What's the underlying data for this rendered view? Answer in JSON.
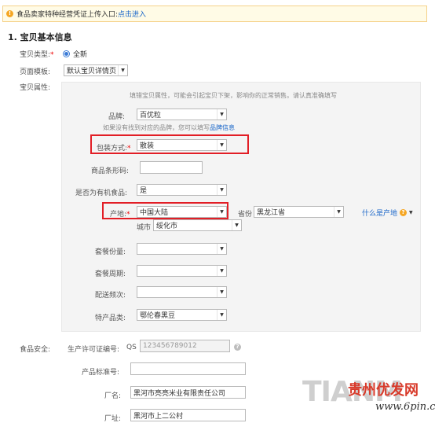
{
  "notice": {
    "text": "食品卖家特种经营凭证上传入口:",
    "link": "点击进入"
  },
  "section_title": "1. 宝贝基本信息",
  "item_type": {
    "label": "宝贝类型:",
    "required_mark": "*",
    "option": "全新"
  },
  "page_template": {
    "label": "页面模板:",
    "value": "默认宝贝详情页"
  },
  "attributes": {
    "label": "宝贝属性:",
    "hint": "填错宝贝属性，可能会引起宝贝下架，影响你的正常销售。请认真准确填写",
    "brand": {
      "label": "品牌:",
      "value": "百优粒"
    },
    "brand_hint": {
      "text": "如果没有找到对应的品牌，您可以填写",
      "link": "品牌信息"
    },
    "packaging": {
      "label": "包装方式:",
      "required_mark": "*",
      "value": "散装"
    },
    "barcode": {
      "label": "商品条形码:",
      "value": ""
    },
    "organic": {
      "label": "是否为有机食品:",
      "value": "是"
    },
    "origin": {
      "label": "产地:",
      "required_mark": "*",
      "value": "中国大陆"
    },
    "province": {
      "label": "省份",
      "value": "黑龙江省"
    },
    "city": {
      "label": "城市",
      "value": "绥化市"
    },
    "origin_help": {
      "text": "什么是产地",
      "icon": "question-icon"
    },
    "package_size": {
      "label": "套餐份量:",
      "value": ""
    },
    "package_period": {
      "label": "套餐周期:",
      "value": ""
    },
    "delivery_freq": {
      "label": "配送频次:",
      "value": ""
    },
    "specialty": {
      "label": "特产品类:",
      "value": "鄂伦春黑豆"
    }
  },
  "food_safety": {
    "label": "食品安全:",
    "license": {
      "label": "生产许可证编号:",
      "prefix": "QS",
      "placeholder": "123456789012"
    },
    "standard": {
      "label": "产品标准号:",
      "value": ""
    },
    "factory_name": {
      "label": "厂名:",
      "value": "黑河市亮亮米业有限责任公司"
    },
    "factory_address": {
      "label": "厂址:",
      "value": "黑河市上二公村"
    }
  },
  "watermark": {
    "brand": "TIANM",
    "cn": "贵州优发网",
    "url": "www.6pin.cn"
  },
  "colors": {
    "highlight_box": "#e21e26",
    "link": "#1a66c9",
    "panel": "#f4f4f4"
  }
}
